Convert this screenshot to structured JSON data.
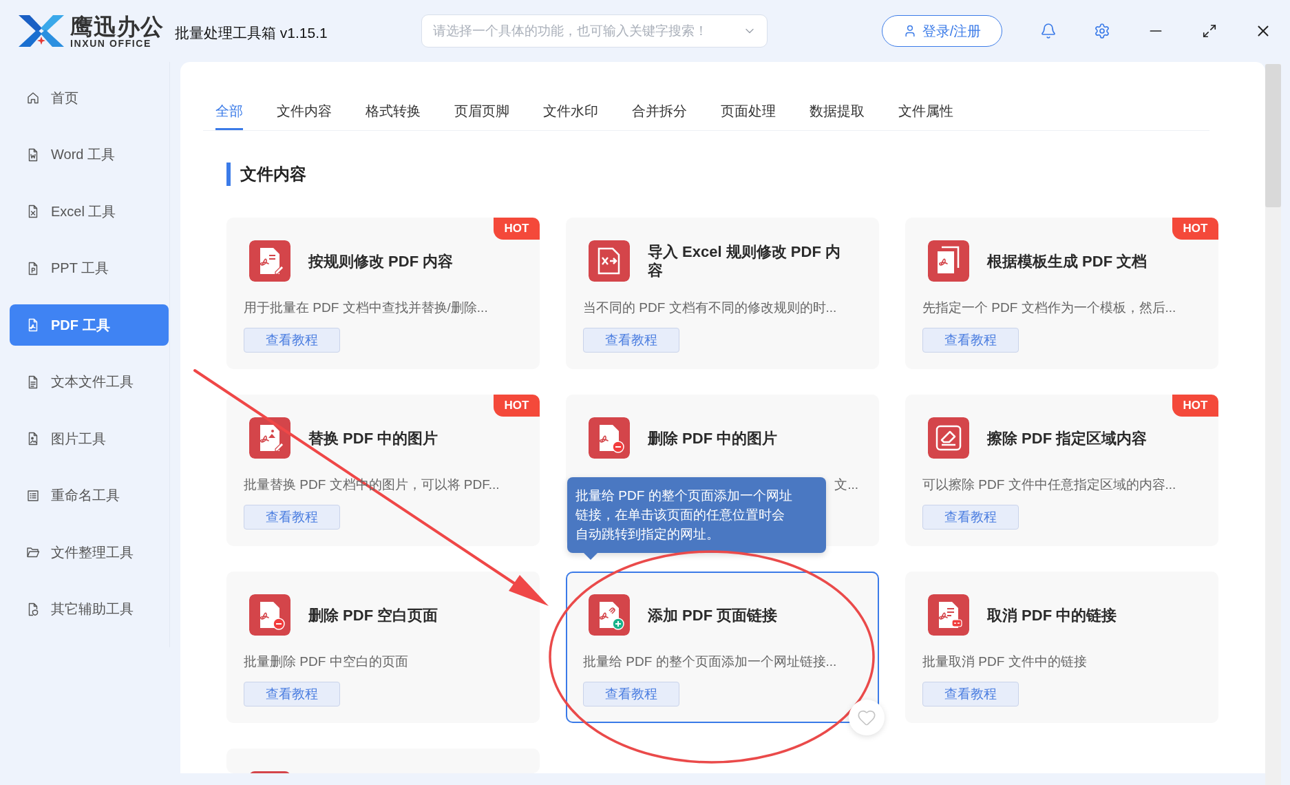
{
  "header": {
    "logo": {
      "name": "鹰迅办公",
      "subtitle": "INXUN OFFICE"
    },
    "app_title": "批量处理工具箱 v1.15.1",
    "search": {
      "placeholder": "请选择一个具体的功能，也可输入关键字搜索！"
    },
    "login_button": "登录/注册"
  },
  "sidebar": {
    "items": [
      {
        "kind": "home",
        "label": "首页",
        "selected": false
      },
      {
        "kind": "word",
        "label": "Word 工具",
        "selected": false
      },
      {
        "kind": "excel",
        "label": "Excel 工具",
        "selected": false
      },
      {
        "kind": "ppt",
        "label": "PPT 工具",
        "selected": false
      },
      {
        "kind": "pdf",
        "label": "PDF 工具",
        "selected": true
      },
      {
        "kind": "text",
        "label": "文本文件工具",
        "selected": false
      },
      {
        "kind": "image",
        "label": "图片工具",
        "selected": false
      },
      {
        "kind": "rename",
        "label": "重命名工具",
        "selected": false
      },
      {
        "kind": "folder",
        "label": "文件整理工具",
        "selected": false
      },
      {
        "kind": "other",
        "label": "其它辅助工具",
        "selected": false
      }
    ]
  },
  "tabs": [
    {
      "label": "全部",
      "selected": true
    },
    {
      "label": "文件内容",
      "selected": false
    },
    {
      "label": "格式转换",
      "selected": false
    },
    {
      "label": "页眉页脚",
      "selected": false
    },
    {
      "label": "文件水印",
      "selected": false
    },
    {
      "label": "合并拆分",
      "selected": false
    },
    {
      "label": "页面处理",
      "selected": false
    },
    {
      "label": "数据提取",
      "selected": false
    },
    {
      "label": "文件属性",
      "selected": false
    }
  ],
  "section": {
    "title": "文件内容",
    "cards": [
      {
        "kind": "edit",
        "title": "按规则修改 PDF 内容",
        "description": "用于批量在 PDF 文档中查找并替换/删除...",
        "button": "查看教程",
        "badge": "HOT",
        "hovered": false
      },
      {
        "kind": "excel",
        "title": "导入 Excel 规则修改 PDF 内容",
        "description": "当不同的 PDF 文档有不同的修改规则的时...",
        "button": "查看教程",
        "hovered": false
      },
      {
        "kind": "template",
        "title": "根据模板生成 PDF 文档",
        "description": "先指定一个 PDF 文档作为一个模板，然后...",
        "button": "查看教程",
        "badge": "HOT",
        "hovered": false
      },
      {
        "kind": "image-edit",
        "title": "替换 PDF 中的图片",
        "description": "批量替换 PDF 文档中的图片，可以将 PDF...",
        "button": "查看教程",
        "badge": "HOT",
        "hovered": false
      },
      {
        "kind": "image-remove",
        "title": "删除 PDF 中的图片",
        "description": "文...",
        "description_covered": true,
        "hovered": false
      },
      {
        "kind": "erase",
        "title": "擦除 PDF 指定区域内容",
        "description": "可以擦除 PDF 文件中任意指定区域的内容...",
        "button": "查看教程",
        "badge": "HOT",
        "hovered": false
      },
      {
        "kind": "page-remove",
        "title": "删除 PDF 空白页面",
        "description": "批量删除 PDF 中空白的页面",
        "button": "查看教程",
        "hovered": false
      },
      {
        "kind": "link-add",
        "title": "添加 PDF 页面链接",
        "description": "批量给 PDF 的整个页面添加一个网址链接...",
        "button": "查看教程",
        "hovered": true,
        "tooltip": "批量给 PDF 的整个页面添加一个网址链接，在单击该页面的任意位置时会自动跳转到指定的网址。"
      },
      {
        "kind": "link-remove",
        "title": "取消 PDF 中的链接",
        "description": "批量取消 PDF 文件中的链接",
        "button": "查看教程",
        "hovered": false
      },
      {
        "kind": "blank",
        "hovered": false
      }
    ]
  }
}
